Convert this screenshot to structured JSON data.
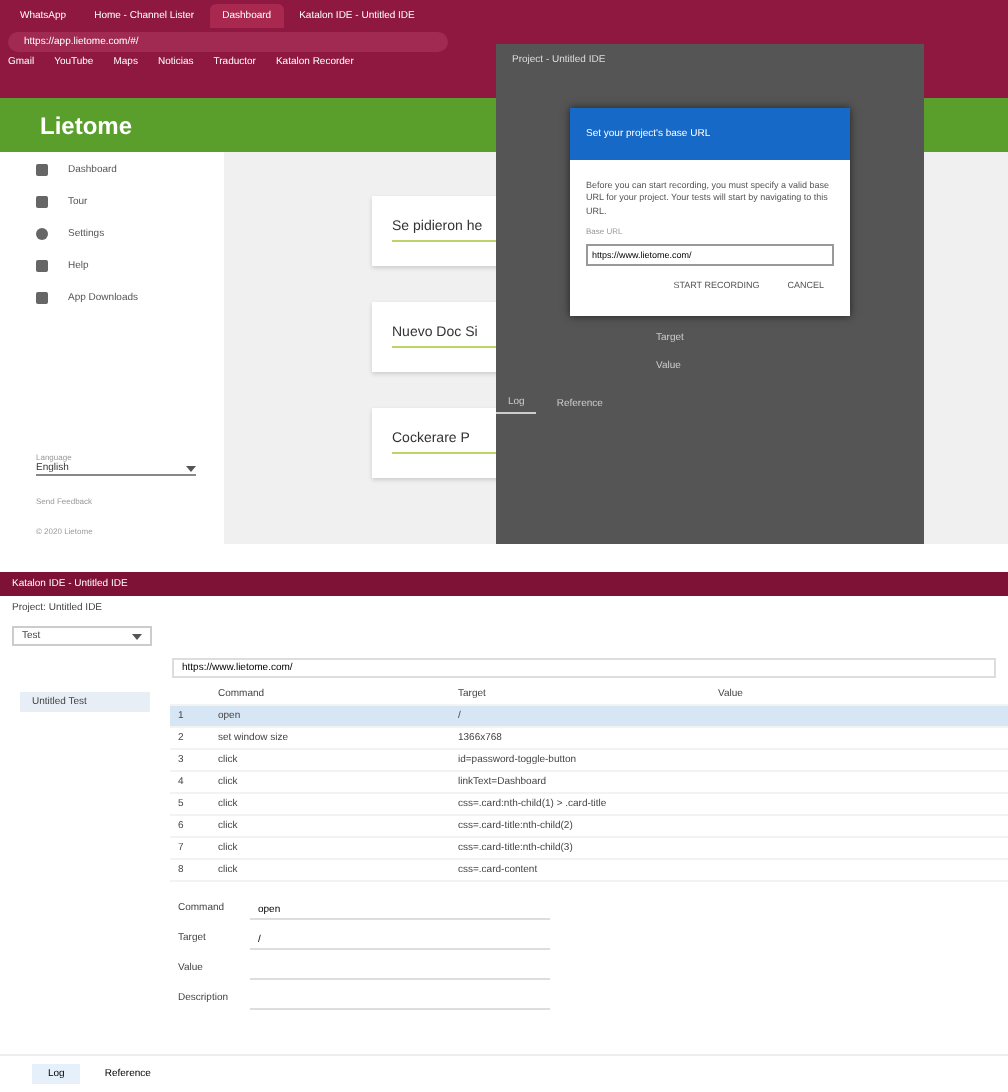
{
  "browser": {
    "tabs": [
      {
        "label": "WhatsApp",
        "selected": false
      },
      {
        "label": "Home - Channel Lister",
        "selected": false
      },
      {
        "label": "Dashboard",
        "selected": true
      },
      {
        "label": "Katalon IDE - Untitled IDE",
        "selected": false
      }
    ],
    "address": "https://app.lietome.com/#/",
    "bookmarks": [
      "Gmail",
      "YouTube",
      "Maps",
      "Noticias",
      "Traductor",
      "Katalon Recorder"
    ]
  },
  "app": {
    "title": "Lietome",
    "sidebar": [
      {
        "label": "Dashboard"
      },
      {
        "label": "Tour"
      },
      {
        "label": "Settings"
      },
      {
        "label": "Help"
      },
      {
        "label": "App Downloads"
      }
    ],
    "language": {
      "label": "Language",
      "value": "English"
    },
    "footer": [
      "Send Feedback",
      "© 2020 Lietome"
    ],
    "cards": [
      "Se pidieron he",
      "Nuevo Doc Si",
      "Cockerare P"
    ]
  },
  "ide_popup": {
    "title": "Project - Untitled IDE",
    "dialog": {
      "title": "Set your project's base URL",
      "body": "Before you can start recording, you must specify a valid base URL for your project. Your tests will start by navigating to this URL.",
      "field_label": "Base URL",
      "field_value": "https://www.lietome.com/",
      "buttons": [
        "START RECORDING",
        "CANCEL"
      ]
    },
    "under": [
      "Target",
      "Value"
    ],
    "tabs": [
      {
        "label": "Log",
        "selected": true
      },
      {
        "label": "Reference",
        "selected": false
      }
    ]
  },
  "ide": {
    "window_title": "Katalon IDE - Untitled IDE",
    "project": "Project: Untitled IDE",
    "test": "Test",
    "url": "https://www.lietome.com/",
    "test_case": "Untitled Test",
    "columns": [
      "Command",
      "Target",
      "Value"
    ],
    "rows": [
      {
        "num": "1",
        "command": "open",
        "target": "/",
        "selected": true
      },
      {
        "num": "2",
        "command": "set window size",
        "target": "1366x768",
        "selected": false
      },
      {
        "num": "3",
        "command": "click",
        "target": "id=password-toggle-button",
        "selected": false
      },
      {
        "num": "4",
        "command": "click",
        "target": "linkText=Dashboard",
        "selected": false
      },
      {
        "num": "5",
        "command": "click",
        "target": "css=.card:nth-child(1) > .card-title",
        "selected": false
      },
      {
        "num": "6",
        "command": "click",
        "target": "css=.card-title:nth-child(2)",
        "selected": false
      },
      {
        "num": "7",
        "command": "click",
        "target": "css=.card-title:nth-child(3)",
        "selected": false
      },
      {
        "num": "8",
        "command": "click",
        "target": "css=.card-content",
        "selected": false
      }
    ],
    "fields": [
      {
        "label": "Command",
        "value": "open"
      },
      {
        "label": "Target",
        "value": "/"
      },
      {
        "label": "Value"
      },
      {
        "label": "Description"
      }
    ],
    "tabs": [
      {
        "label": "Log",
        "selected": true
      },
      {
        "label": "Reference",
        "selected": false
      }
    ]
  }
}
